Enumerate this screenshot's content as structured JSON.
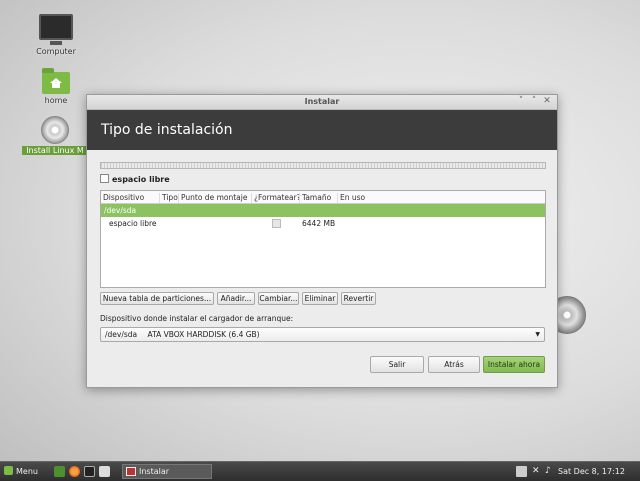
{
  "desktop": {
    "icons": [
      {
        "label": "Computer"
      },
      {
        "label": "home"
      },
      {
        "label": "Install Linux M"
      }
    ]
  },
  "window": {
    "title": "Instalar",
    "controls": {
      "minimize": "˅",
      "maximize": "˄",
      "close": "✕"
    },
    "header": "Tipo de instalación",
    "free_space_label": "espacio libre",
    "table": {
      "columns": [
        "Dispositivo",
        "Tipo",
        "Punto de montaje",
        "¿Formatear?",
        "Tamaño",
        "En uso"
      ],
      "rows": [
        {
          "device": "/dev/sda",
          "type": "",
          "mount": "",
          "size": "",
          "used": ""
        },
        {
          "device": "espacio libre",
          "type": "",
          "mount": "",
          "size": "6442 MB",
          "used": ""
        }
      ]
    },
    "buttons": {
      "new_table": "Nueva tabla de particiones...",
      "add": "Añadir...",
      "change": "Cambiar...",
      "delete": "Eliminar",
      "revert": "Revertir"
    },
    "boot_loader_label": "Dispositivo donde instalar el cargador de arranque:",
    "boot_device": {
      "path": "/dev/sda",
      "name": "ATA VBOX HARDDISK (6.4 GB)"
    },
    "actions": {
      "quit": "Salir",
      "back": "Atrás",
      "install": "Instalar ahora"
    }
  },
  "taskbar": {
    "menu_label": "Menu",
    "task_label": "Instalar",
    "clock": "Sat Dec  8, 17:12"
  },
  "colors": {
    "accent": "#8cc25f",
    "header_bg": "#3c3c3c"
  }
}
